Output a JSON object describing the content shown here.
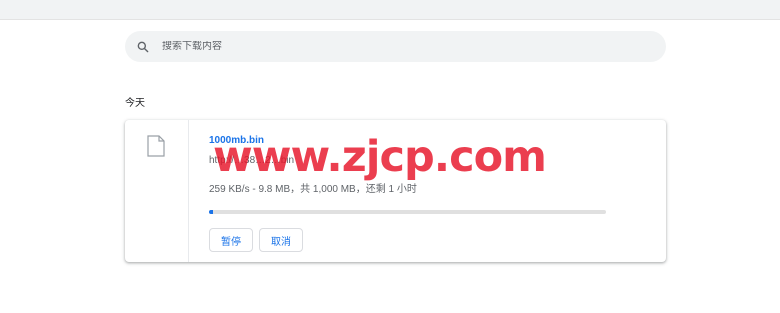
{
  "search": {
    "placeholder": "搜索下载内容"
  },
  "section": {
    "title": "今天"
  },
  "download": {
    "filename": "1000mb.bin",
    "url": "http://…38…2…bin",
    "status": "259 KB/s - 9.8 MB，共 1,000 MB，还剩 1 小时",
    "progress_percent": 1,
    "pause_label": "暂停",
    "cancel_label": "取消"
  },
  "watermark": "www.zjcp.com",
  "colors": {
    "accent": "#1a73e8",
    "watermark": "#e61428"
  },
  "icons": {
    "search": "search-icon",
    "file": "file-icon"
  }
}
